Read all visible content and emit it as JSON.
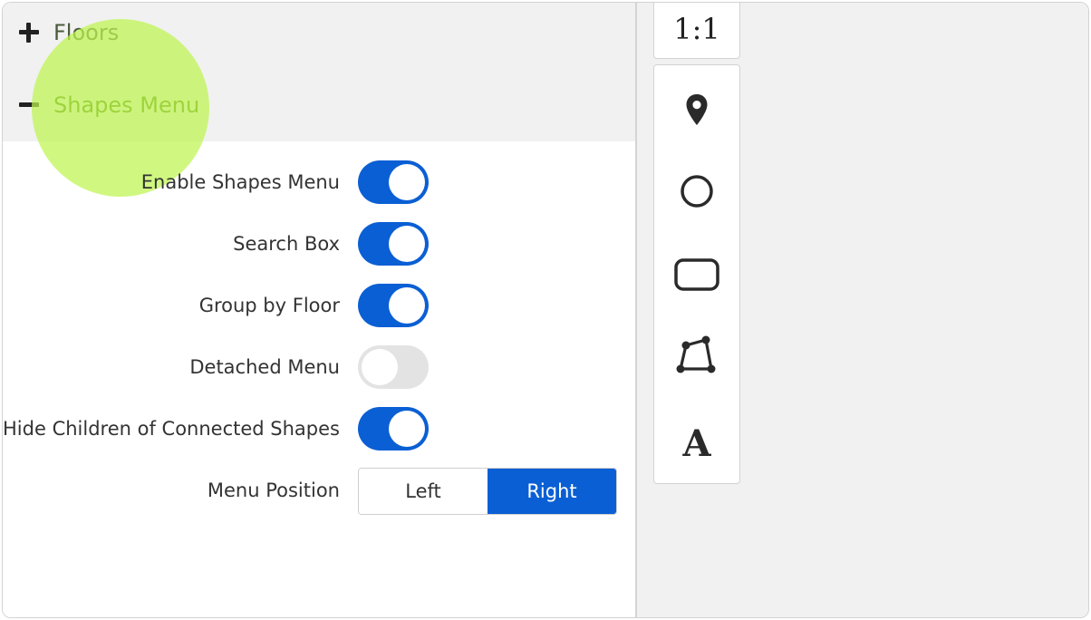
{
  "accordion": {
    "floors": {
      "label": "Floors",
      "icon": "plus-icon",
      "expanded": false
    },
    "shapes_menu": {
      "label": "Shapes Menu",
      "icon": "minus-icon",
      "expanded": true
    }
  },
  "settings": {
    "enable_shapes_menu": {
      "label": "Enable Shapes Menu",
      "on": true
    },
    "search_box": {
      "label": "Search Box",
      "on": true
    },
    "group_by_floor": {
      "label": "Group by Floor",
      "on": true
    },
    "detached_menu": {
      "label": "Detached Menu",
      "on": false
    },
    "hide_children": {
      "label": "Hide Children of Connected Shapes",
      "on": true
    },
    "menu_position": {
      "label": "Menu Position",
      "options": [
        "Left",
        "Right"
      ],
      "selected": "Right"
    }
  },
  "zoom": {
    "label": "1:1"
  },
  "toolbar": {
    "tools": [
      "marker-pin-icon",
      "circle-icon",
      "rounded-rectangle-icon",
      "polygon-icon",
      "text-icon"
    ],
    "text_tool_glyph": "A"
  },
  "colors": {
    "accent": "#0b5fd4",
    "toggle_off": "#e3e3e3",
    "highlight": "#bef550",
    "panel_bg": "#f1f1f1"
  }
}
